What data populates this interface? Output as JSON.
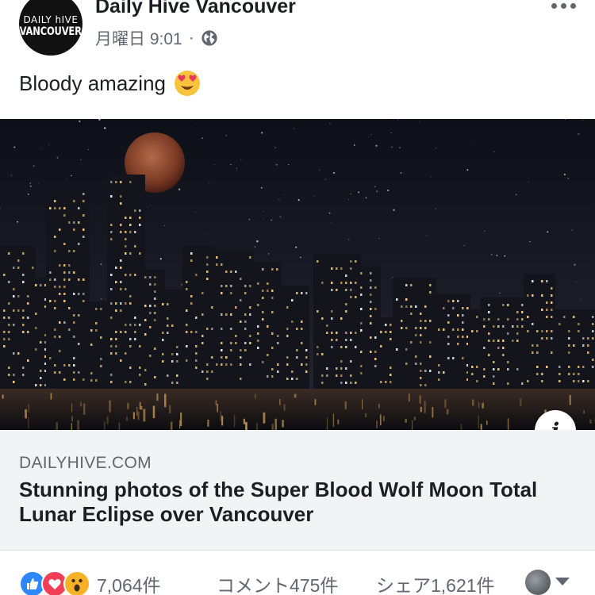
{
  "post": {
    "page_name": "Daily Hive Vancouver",
    "avatar_line1": "DAILY hIVE",
    "avatar_line2": "VANCOUVER",
    "timestamp": "月曜日 9:01",
    "separator": "·",
    "privacy_icon": "globe-icon",
    "more_icon": "more-dots-icon",
    "text": "Bloody amazing",
    "emoji_icon": "heart-eyes-emoji-icon"
  },
  "link": {
    "domain": "DAILYHIVE.COM",
    "title": "Stunning photos of the Super Blood Wolf Moon Total Lunar Eclipse over Vancouver",
    "info_label": "i"
  },
  "engagement": {
    "reaction_icons": [
      "like-icon",
      "love-icon",
      "wow-icon"
    ],
    "reactions_count": "7,064件",
    "comments": "コメント475件",
    "shares": "シェア1,621件"
  },
  "colors": {
    "like": "#2d88ff",
    "love": "#f33e58",
    "wow": "#f7b125",
    "text_primary": "#1c1e21",
    "text_secondary": "#606770",
    "link_bg": "#f2f3f5"
  }
}
